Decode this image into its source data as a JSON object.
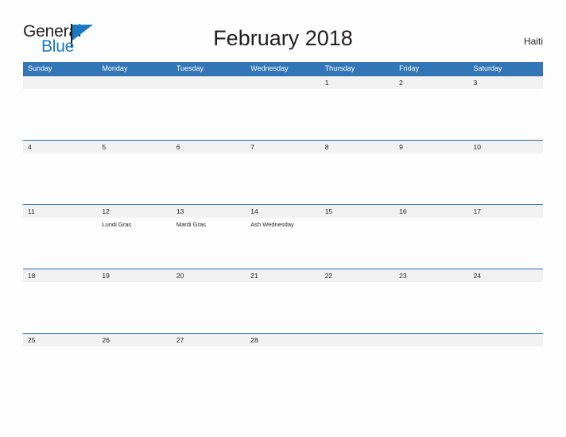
{
  "logo": {
    "word_one": "General",
    "word_two": "Blue",
    "flag_icon": "blue-flag-triangle-icon",
    "accent_color": "#1b78c2"
  },
  "header": {
    "title": "February 2018",
    "location": "Haiti"
  },
  "theme": {
    "header_blue": "#3376b8",
    "row_line_blue": "#2e6da4",
    "band_gray": "#f1f1f1",
    "text_color": "#231f20",
    "page_background": "#fdfdfd"
  },
  "calendar": {
    "weekdays": [
      "Sunday",
      "Monday",
      "Tuesday",
      "Wednesday",
      "Thursday",
      "Friday",
      "Saturday"
    ],
    "weeks": [
      [
        {
          "date": "",
          "event": ""
        },
        {
          "date": "",
          "event": ""
        },
        {
          "date": "",
          "event": ""
        },
        {
          "date": "",
          "event": ""
        },
        {
          "date": "1",
          "event": ""
        },
        {
          "date": "2",
          "event": ""
        },
        {
          "date": "3",
          "event": ""
        }
      ],
      [
        {
          "date": "4",
          "event": ""
        },
        {
          "date": "5",
          "event": ""
        },
        {
          "date": "6",
          "event": ""
        },
        {
          "date": "7",
          "event": ""
        },
        {
          "date": "8",
          "event": ""
        },
        {
          "date": "9",
          "event": ""
        },
        {
          "date": "10",
          "event": ""
        }
      ],
      [
        {
          "date": "11",
          "event": ""
        },
        {
          "date": "12",
          "event": "Lundi Gras"
        },
        {
          "date": "13",
          "event": "Mardi Gras"
        },
        {
          "date": "14",
          "event": "Ash Wednesday"
        },
        {
          "date": "15",
          "event": ""
        },
        {
          "date": "16",
          "event": ""
        },
        {
          "date": "17",
          "event": ""
        }
      ],
      [
        {
          "date": "18",
          "event": ""
        },
        {
          "date": "19",
          "event": ""
        },
        {
          "date": "20",
          "event": ""
        },
        {
          "date": "21",
          "event": ""
        },
        {
          "date": "22",
          "event": ""
        },
        {
          "date": "23",
          "event": ""
        },
        {
          "date": "24",
          "event": ""
        }
      ],
      [
        {
          "date": "25",
          "event": ""
        },
        {
          "date": "26",
          "event": ""
        },
        {
          "date": "27",
          "event": ""
        },
        {
          "date": "28",
          "event": ""
        },
        {
          "date": "",
          "event": ""
        },
        {
          "date": "",
          "event": ""
        },
        {
          "date": "",
          "event": ""
        }
      ]
    ]
  }
}
